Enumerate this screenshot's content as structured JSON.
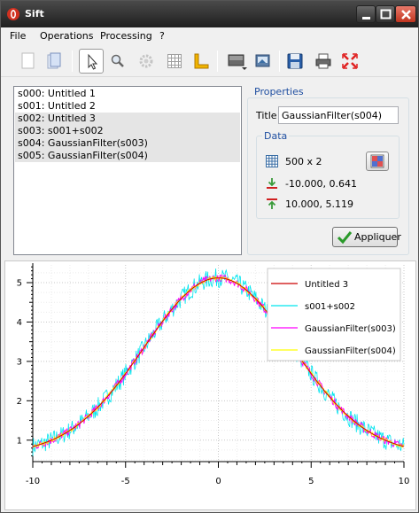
{
  "window": {
    "title": "Sift"
  },
  "menu": [
    "File",
    "Operations",
    "Processing",
    "?"
  ],
  "toolbar": [
    "new-signal-icon",
    "open-icon",
    "select-tool-icon",
    "zoom-tool-icon",
    "settings-icon",
    "grid-icon",
    "ruler-icon",
    "curve-style-icon",
    "export-image-icon",
    "save-icon",
    "print-icon",
    "fullscreen-icon"
  ],
  "signals": [
    "s000: Untitled 1",
    "s001: Untitled 2",
    "s002: Untitled 3",
    "s003: s001+s002",
    "s004: GaussianFilter(s003)",
    "s005: GaussianFilter(s004)"
  ],
  "properties": {
    "title": "Properties",
    "title_label": "Title",
    "title_value": "GaussianFilter(s004)",
    "data_title": "Data",
    "size": "500 x 2",
    "min_point": "-10.000, 0.641",
    "max_point": "10.000, 5.119",
    "apply_label": "Appliquer"
  },
  "colors": {
    "accent": "#1f4fa1",
    "red": "#cc0000",
    "cyan": "#00e5ee",
    "magenta": "#ff00ff",
    "yellow": "#ffff00"
  },
  "chart_data": {
    "type": "line",
    "x_ticks": [
      "-10",
      "-5",
      "0",
      "5",
      "10"
    ],
    "y_ticks": [
      "1",
      "2",
      "3",
      "4",
      "5"
    ],
    "xlim": [
      -10,
      10
    ],
    "ylim": [
      0.5,
      5.45
    ],
    "grid": true,
    "legend_position": "top-right",
    "series": [
      {
        "name": "Untitled 3",
        "color": "#cc0000",
        "formula": "0.641 + 4.478*exp(-x^2/(2*4^2))",
        "noise": 0
      },
      {
        "name": "s001+s002",
        "color": "#00e5ee",
        "formula": "0.641 + 4.478*exp(-x^2/(2*4^2))",
        "noise": 0.22
      },
      {
        "name": "GaussianFilter(s003)",
        "color": "#ff00ff",
        "formula": "0.641 + 4.478*exp(-x^2/(2*4^2))",
        "noise": 0.09
      },
      {
        "name": "GaussianFilter(s004)",
        "color": "#ffff00",
        "formula": "0.641 + 4.478*exp(-x^2/(2*4^2))",
        "noise": 0.04
      }
    ]
  }
}
